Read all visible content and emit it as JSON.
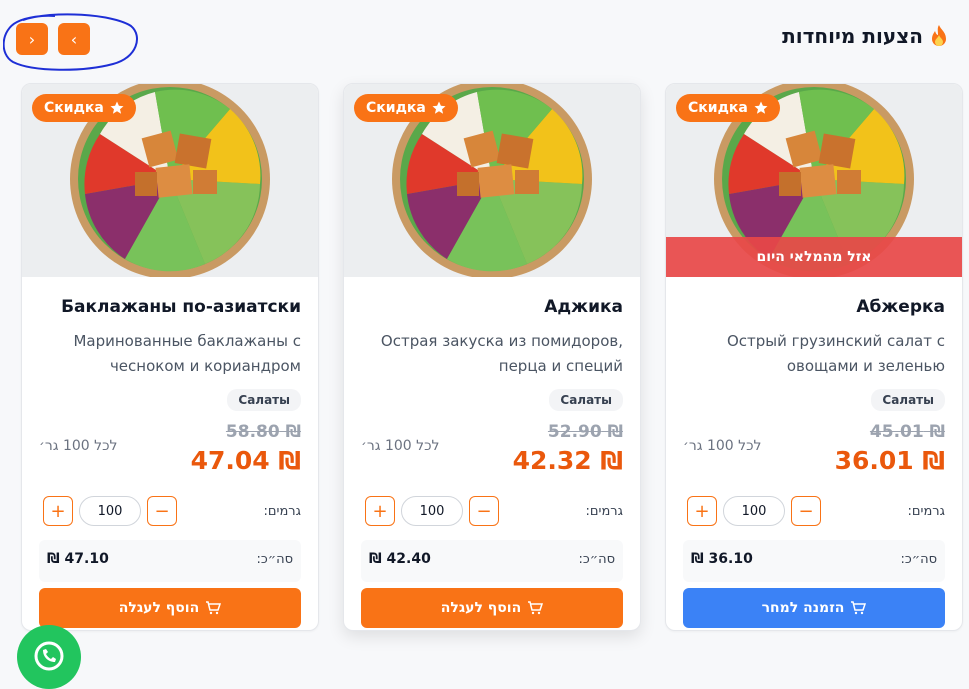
{
  "header": {
    "title": "הצעות מיוחדות",
    "icon": "fire-icon"
  },
  "nav": {
    "next_icon": "›",
    "prev_icon": "‹"
  },
  "colors": {
    "accent": "#f97316",
    "price": "#ea580c",
    "sold_out": "#e84848",
    "preorder": "#3b82f6",
    "whatsapp": "#22c55e"
  },
  "products": [
    {
      "badge": "Скидка",
      "sold_out_label": "אזל מהמלאי היום",
      "name": "Абжерка",
      "description": "Острый грузинский салат с овощами и зеленью",
      "category": "Салаты",
      "old_price": "₪ 45.01",
      "new_price": "₪ 36.01",
      "unit": "לכל 100 גר׳",
      "grams_label": "גרמים:",
      "quantity": "100",
      "total_label": "סה״כ:",
      "total": "₪ 36.10",
      "cta": "הזמנה למחר"
    },
    {
      "badge": "Скидка",
      "name": "Аджика",
      "description": "Острая закуска из помидоров, перца и специй",
      "category": "Салаты",
      "old_price": "₪ 52.90",
      "new_price": "₪ 42.32",
      "unit": "לכל 100 גר׳",
      "grams_label": "גרמים:",
      "quantity": "100",
      "total_label": "סה״כ:",
      "total": "₪ 42.40",
      "cta": "הוסף לעגלה"
    },
    {
      "badge": "Скидка",
      "name": "Баклажаны по-азиатски",
      "description": "Маринованные баклажаны с чесноком и кориандром",
      "category": "Салаты",
      "old_price": "₪ 58.80",
      "new_price": "₪ 47.04",
      "unit": "לכל 100 גר׳",
      "grams_label": "גרמים:",
      "quantity": "100",
      "total_label": "סה״כ:",
      "total": "₪ 47.10",
      "cta": "הוסף לעגלה"
    }
  ]
}
